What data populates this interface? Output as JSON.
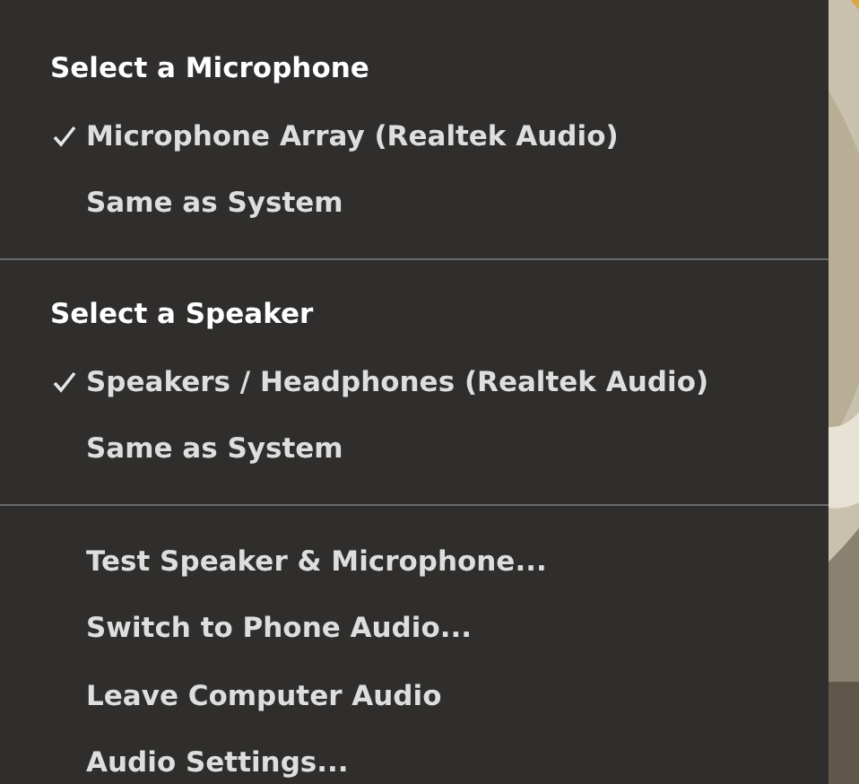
{
  "menu": {
    "sections": [
      {
        "kind": "device_list",
        "title": "Select a Microphone",
        "items": [
          {
            "label": "Microphone Array (Realtek Audio)",
            "checked": true
          },
          {
            "label": "Same as System",
            "checked": false
          }
        ]
      },
      {
        "kind": "device_list",
        "title": "Select a Speaker",
        "items": [
          {
            "label": "Speakers / Headphones (Realtek Audio)",
            "checked": true
          },
          {
            "label": "Same as System",
            "checked": false
          }
        ]
      },
      {
        "kind": "actions",
        "items": [
          {
            "label": "Test Speaker & Microphone..."
          },
          {
            "label": "Switch to Phone Audio..."
          },
          {
            "label": "Leave Computer Audio"
          },
          {
            "label": "Audio Settings..."
          }
        ]
      }
    ]
  }
}
